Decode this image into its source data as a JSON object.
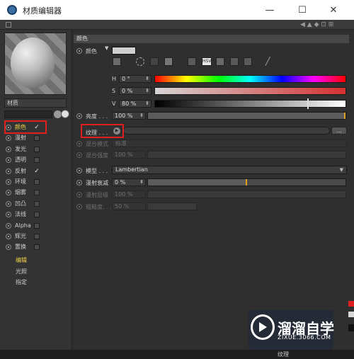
{
  "window": {
    "title": "材质编辑器",
    "minimize": "—",
    "maximize": "☐",
    "close": "✕"
  },
  "left": {
    "material_name": "材质",
    "channels": [
      {
        "label": "颜色",
        "checked": "✓",
        "active": true
      },
      {
        "label": "漫射",
        "checked": ""
      },
      {
        "label": "发光",
        "checked": ""
      },
      {
        "label": "透明",
        "checked": ""
      },
      {
        "label": "反射",
        "checked": "✓"
      },
      {
        "label": "环境",
        "checked": ""
      },
      {
        "label": "烟雾",
        "checked": ""
      },
      {
        "label": "凹凸",
        "checked": ""
      },
      {
        "label": "法线",
        "checked": ""
      },
      {
        "label": "Alpha",
        "checked": ""
      },
      {
        "label": "辉光",
        "checked": ""
      },
      {
        "label": "置换",
        "checked": ""
      }
    ],
    "subs": [
      "编辑",
      "光照",
      "指定"
    ]
  },
  "right": {
    "section_title": "颜色",
    "color_label": "颜色",
    "hsv_label": "HSV",
    "h": {
      "label": "H",
      "value": "0 °"
    },
    "s": {
      "label": "S",
      "value": "0 %"
    },
    "v": {
      "label": "V",
      "value": "80 %"
    },
    "brightness": {
      "label": "亮度 . . .",
      "value": "100 %",
      "fill": 1.0
    },
    "texture": {
      "label": "纹理 . . .",
      "more": "..."
    },
    "blend_mode": {
      "label": "混合模式",
      "value": "标准"
    },
    "blend_strength": {
      "label": "混合强度",
      "value": "100 %"
    },
    "model": {
      "label": "模型 . . .",
      "value": "Lambertian"
    },
    "diffuse_falloff": {
      "label": "漫射衰减",
      "value": "0 %",
      "fill": 0.5
    },
    "diffuse_level": {
      "label": "漫射层级",
      "value": "100 %"
    },
    "roughness": {
      "label": "粗糙度. . .",
      "value": "50 %"
    }
  },
  "watermark": {
    "line1": "溜溜自学",
    "line2": "ZIXUE.3066.COM"
  },
  "bottom": {
    "label": "纹理"
  }
}
